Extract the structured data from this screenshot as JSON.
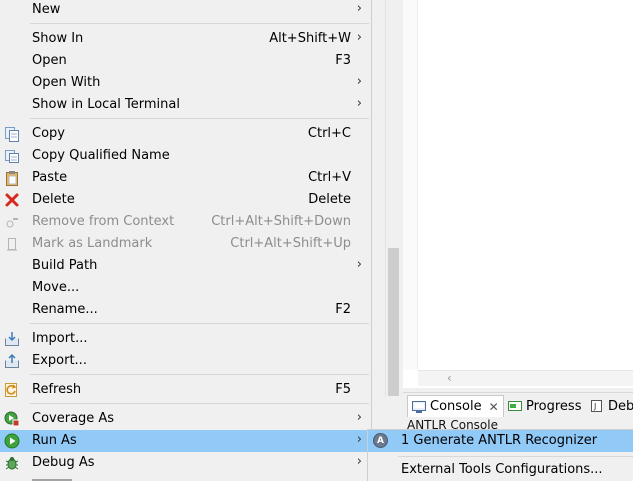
{
  "context_menu": {
    "items": [
      {
        "label": "New",
        "shortcut": "",
        "submenu": true,
        "icon": "",
        "disabled": false
      },
      {
        "label": "Show In",
        "shortcut": "Alt+Shift+W",
        "submenu": true,
        "icon": "",
        "disabled": false
      },
      {
        "label": "Open",
        "shortcut": "F3",
        "submenu": false,
        "icon": "",
        "disabled": false
      },
      {
        "label": "Open With",
        "shortcut": "",
        "submenu": true,
        "icon": "",
        "disabled": false
      },
      {
        "label": "Show in Local Terminal",
        "shortcut": "",
        "submenu": true,
        "icon": "",
        "disabled": false
      },
      {
        "label": "Copy",
        "shortcut": "Ctrl+C",
        "submenu": false,
        "icon": "copy-icon",
        "disabled": false
      },
      {
        "label": "Copy Qualified Name",
        "shortcut": "",
        "submenu": false,
        "icon": "copy-qualified-name-icon",
        "disabled": false
      },
      {
        "label": "Paste",
        "shortcut": "Ctrl+V",
        "submenu": false,
        "icon": "paste-icon",
        "disabled": false
      },
      {
        "label": "Delete",
        "shortcut": "Delete",
        "submenu": false,
        "icon": "delete-icon",
        "disabled": false
      },
      {
        "label": "Remove from Context",
        "shortcut": "Ctrl+Alt+Shift+Down",
        "submenu": false,
        "icon": "remove-context-icon",
        "disabled": true
      },
      {
        "label": "Mark as Landmark",
        "shortcut": "Ctrl+Alt+Shift+Up",
        "submenu": false,
        "icon": "landmark-icon",
        "disabled": true
      },
      {
        "label": "Build Path",
        "shortcut": "",
        "submenu": true,
        "icon": "",
        "disabled": false
      },
      {
        "label": "Move...",
        "shortcut": "",
        "submenu": false,
        "icon": "",
        "disabled": false
      },
      {
        "label": "Rename...",
        "shortcut": "F2",
        "submenu": false,
        "icon": "",
        "disabled": false
      },
      {
        "label": "Import...",
        "shortcut": "",
        "submenu": false,
        "icon": "import-icon",
        "disabled": false
      },
      {
        "label": "Export...",
        "shortcut": "",
        "submenu": false,
        "icon": "export-icon",
        "disabled": false
      },
      {
        "label": "Refresh",
        "shortcut": "F5",
        "submenu": false,
        "icon": "refresh-icon",
        "disabled": false
      },
      {
        "label": "Coverage As",
        "shortcut": "",
        "submenu": true,
        "icon": "coverage-icon",
        "disabled": false
      },
      {
        "label": "Run As",
        "shortcut": "",
        "submenu": true,
        "icon": "run-icon",
        "disabled": false,
        "highlighted": true
      },
      {
        "label": "Debug As",
        "shortcut": "",
        "submenu": true,
        "icon": "debug-icon",
        "disabled": false
      }
    ],
    "submenu_arrow": "›"
  },
  "run_as_submenu": {
    "items": [
      {
        "label": "1 Generate ANTLR Recognizer",
        "icon": "antlr-icon",
        "icon_text": "A",
        "highlighted": true
      },
      {
        "label": "External Tools Configurations...",
        "icon": "",
        "highlighted": false
      }
    ]
  },
  "bottom_panel": {
    "tabs": [
      {
        "label": "Console",
        "icon": "console-icon",
        "active": true,
        "close": "✕"
      },
      {
        "label": "Progress",
        "icon": "progress-icon",
        "active": false
      },
      {
        "label": "Debu",
        "icon": "debug-tab-icon",
        "active": false
      }
    ],
    "console_title": "ANTLR Console"
  },
  "colors": {
    "menu_bg": "#f0f0f0",
    "highlight": "#91c9f7",
    "disabled_text": "#8d8d8d",
    "delete_red": "#d42a1f"
  }
}
